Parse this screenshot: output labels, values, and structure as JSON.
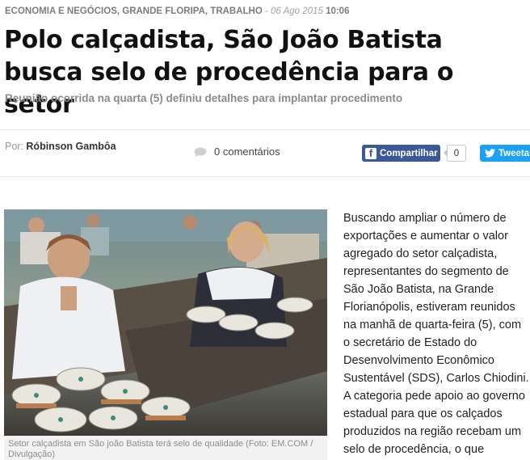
{
  "article": {
    "categories": "ECONOMIA E NEGÓCIOS, GRANDE FLORIPA, TRABALHO",
    "date_sep": " - ",
    "date": "06 Ago 2015",
    "time": "10:06",
    "headline": "Polo calçadista, São João Batista busca selo de procedência para o setor",
    "subtitle": "Reunião ocorrida na quarta (5) definiu detalhes para implantar procedimento",
    "byline_label": "Por: ",
    "author": "Róbinson Gambôa",
    "comments_label": "0 comentários",
    "share": {
      "facebook_label": "Compartilhar",
      "facebook_count": "0",
      "twitter_label": "Tweetar"
    },
    "photo_caption": "Setor calçadista em São joão Batista terá selo de qualidade (Foto: EM.COM / Divulgação)",
    "body_lines": [
      "Buscando ampliar o número de",
      "exportações e aumentar o valor",
      "agregado do setor calçadista,",
      "representantes do segmento de",
      "São João Batista, na Grande",
      "Florianópolis, estiveram reunidos",
      "na manhã de quarta-feira (5), com",
      "o secretário de Estado do",
      "Desenvolvimento Econômico",
      "Sustentável (SDS), Carlos Chiodini.",
      "A categoria pede apoio ao governo",
      "estadual para que os calçados",
      "produzidos na região recebam um",
      "selo de procedência, o que"
    ]
  },
  "colors": {
    "facebook": "#3b5998",
    "twitter": "#1da1f2",
    "meta_gray": "#7c7c7c"
  },
  "icons": {
    "comments": "speech-bubble-icon",
    "facebook": "facebook-f-icon",
    "twitter": "twitter-bird-icon"
  }
}
